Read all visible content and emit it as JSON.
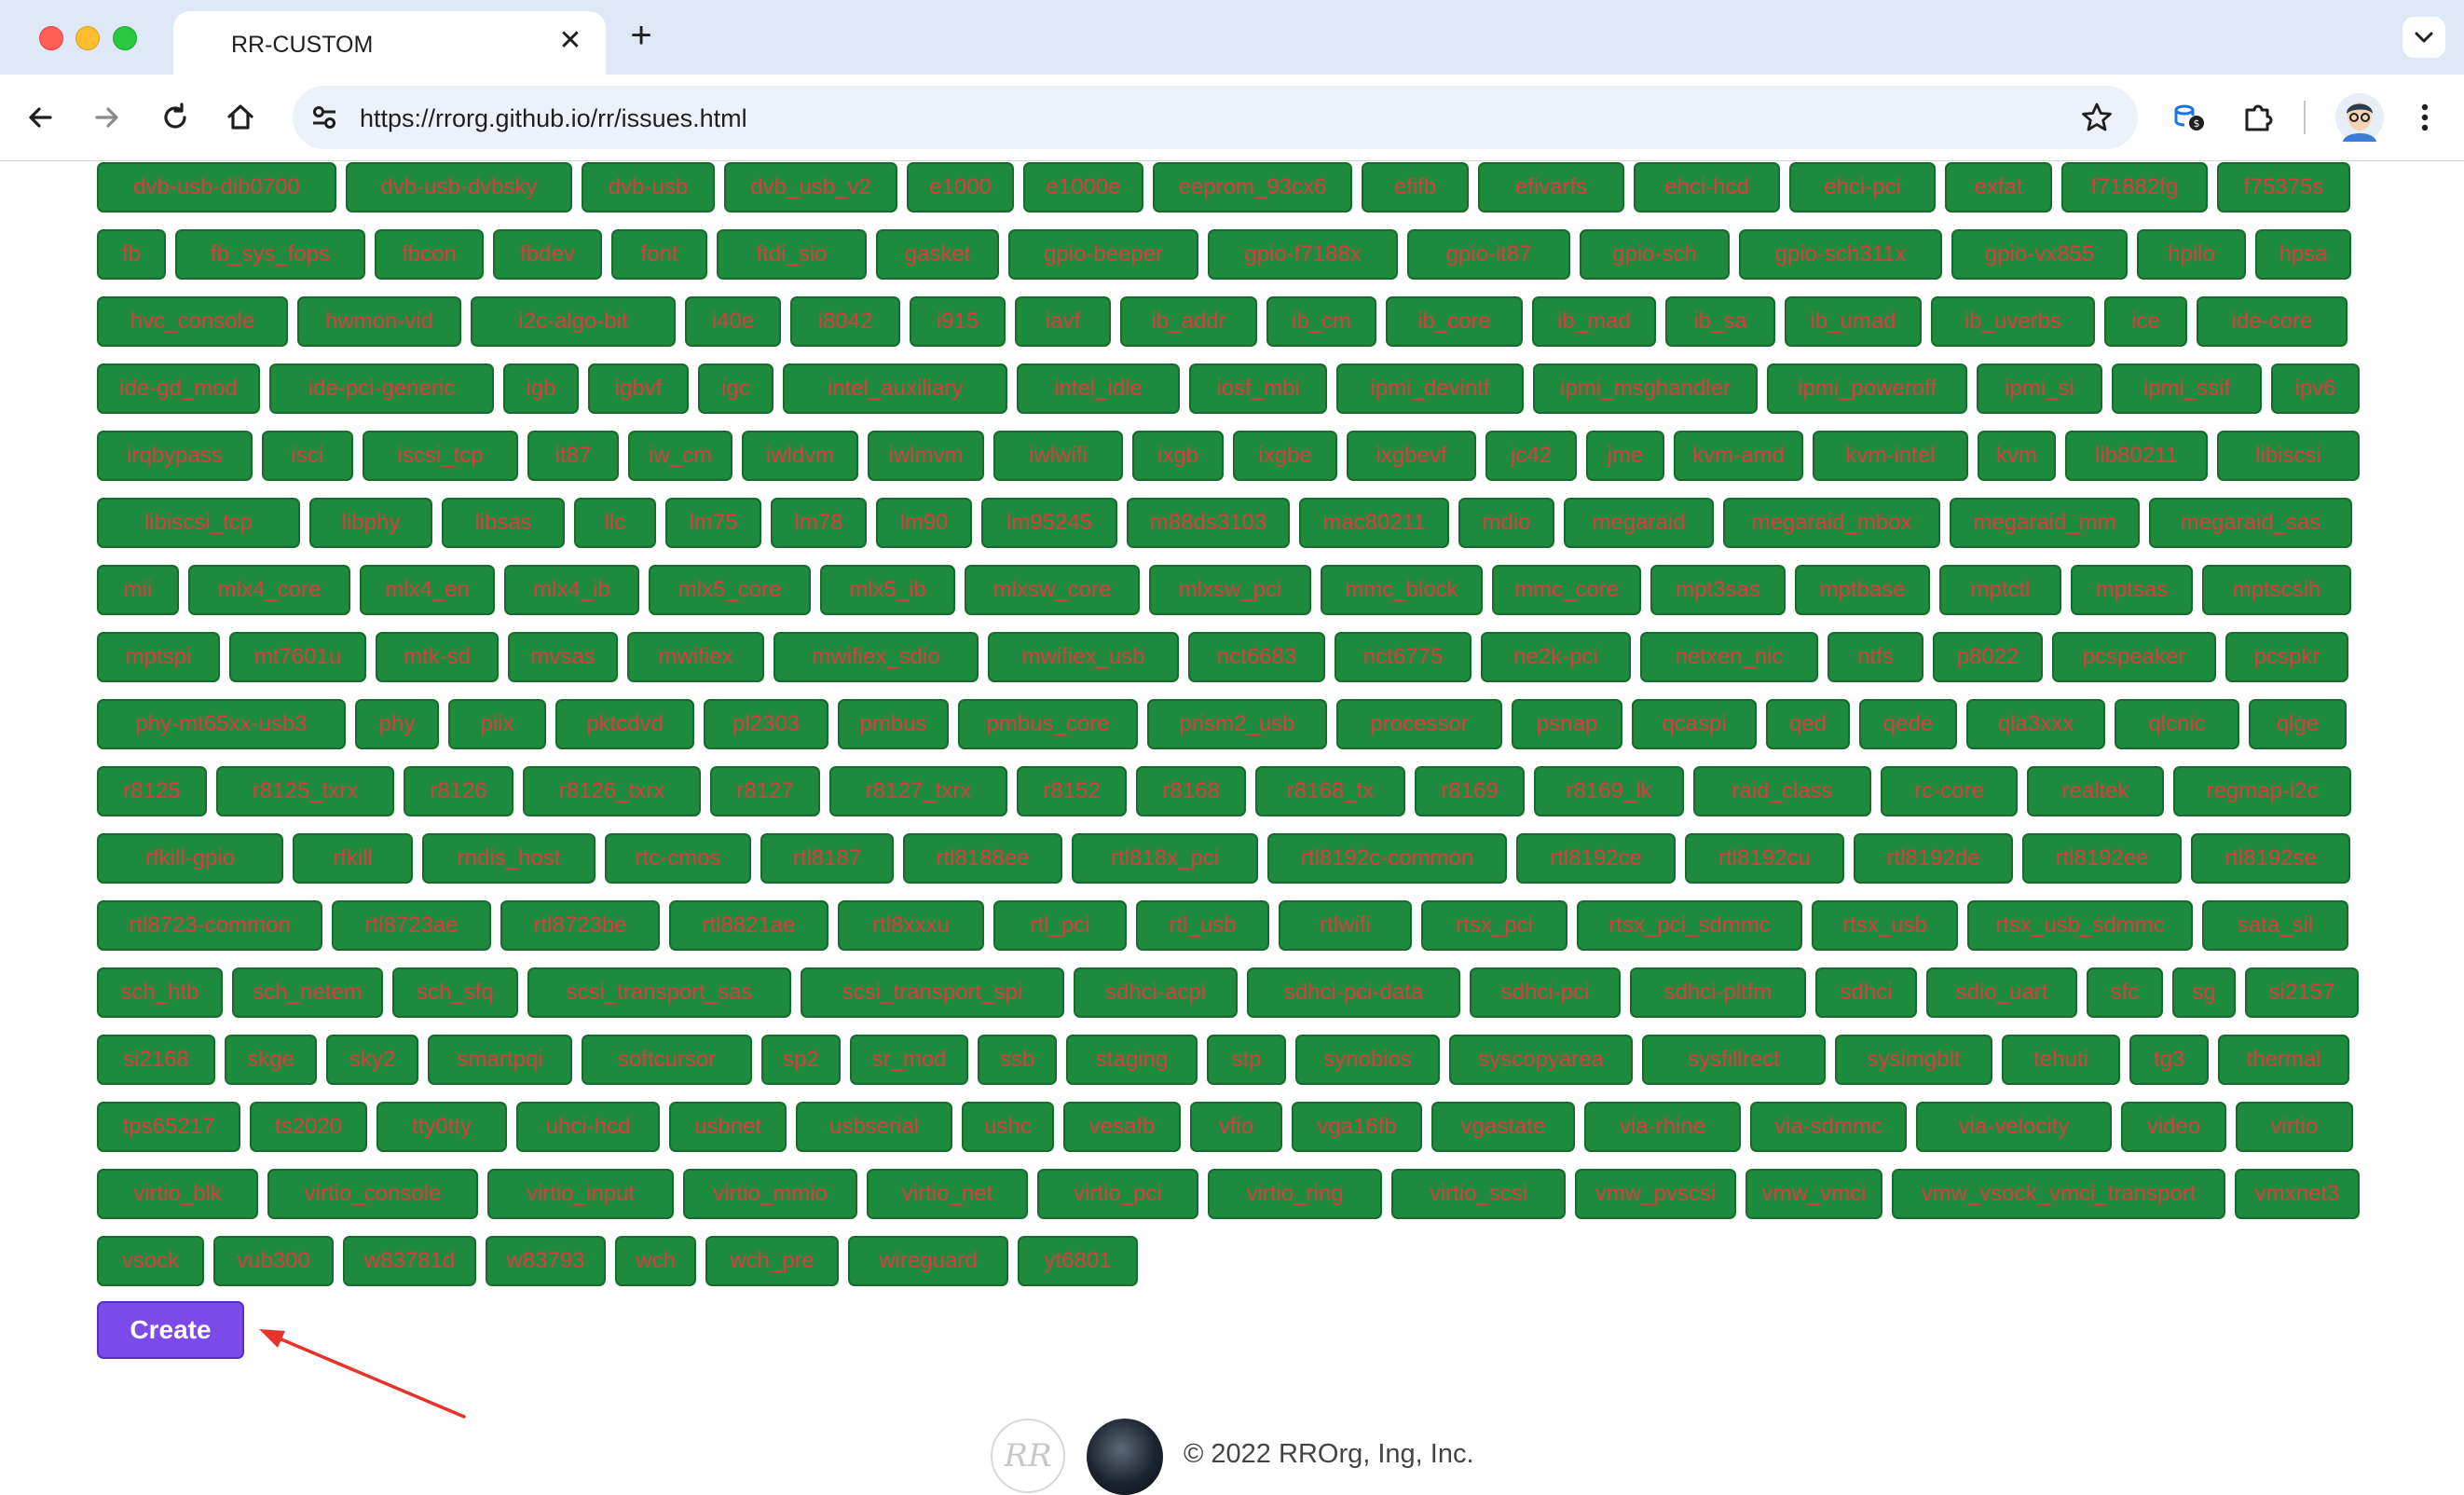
{
  "browser": {
    "tab_title": "RR-CUSTOM",
    "url": "https://rrorg.github.io/rr/issues.html"
  },
  "page": {
    "tags": [
      [
        "dvb-usb-dib0700",
        "dvb-usb-dvbsky",
        "dvb-usb",
        "dvb_usb_v2",
        "e1000",
        "e1000e",
        "eeprom_93cx6",
        "efifb",
        "efivarfs",
        "ehci-hcd",
        "ehci-pci",
        "exfat",
        "f71882fg",
        "f75375s"
      ],
      [
        "fb",
        "fb_sys_fops",
        "fbcon",
        "fbdev",
        "font",
        "ftdi_sio",
        "gasket",
        "gpio-beeper",
        "gpio-f7188x",
        "gpio-it87",
        "gpio-sch",
        "gpio-sch311x",
        "gpio-vx855",
        "hpilo",
        "hpsa"
      ],
      [
        "hvc_console",
        "hwmon-vid",
        "i2c-algo-bit",
        "i40e",
        "i8042",
        "i915",
        "iavf",
        "ib_addr",
        "ib_cm",
        "ib_core",
        "ib_mad",
        "ib_sa",
        "ib_umad",
        "ib_uverbs",
        "ice",
        "ide-core"
      ],
      [
        "ide-gd_mod",
        "ide-pci-generic",
        "igb",
        "igbvf",
        "igc",
        "intel_auxiliary",
        "intel_idle",
        "iosf_mbi",
        "ipmi_devintf",
        "ipmi_msghandler",
        "ipmi_poweroff",
        "ipmi_si",
        "ipmi_ssif",
        "ipv6"
      ],
      [
        "irqbypass",
        "isci",
        "iscsi_tcp",
        "it87",
        "iw_cm",
        "iwldvm",
        "iwlmvm",
        "iwlwifi",
        "ixgb",
        "ixgbe",
        "ixgbevf",
        "jc42",
        "jme",
        "kvm-amd",
        "kvm-intel",
        "kvm",
        "lib80211",
        "libiscsi"
      ],
      [
        "libiscsi_tcp",
        "libphy",
        "libsas",
        "llc",
        "lm75",
        "lm78",
        "lm90",
        "lm95245",
        "m88ds3103",
        "mac80211",
        "mdio",
        "megaraid",
        "megaraid_mbox",
        "megaraid_mm",
        "megaraid_sas"
      ],
      [
        "mii",
        "mlx4_core",
        "mlx4_en",
        "mlx4_ib",
        "mlx5_core",
        "mlx5_ib",
        "mlxsw_core",
        "mlxsw_pci",
        "mmc_block",
        "mmc_core",
        "mpt3sas",
        "mptbase",
        "mptctl",
        "mptsas",
        "mptscsih"
      ],
      [
        "mptspi",
        "mt7601u",
        "mtk-sd",
        "mvsas",
        "mwifiex",
        "mwifiex_sdio",
        "mwifiex_usb",
        "nct6683",
        "nct6775",
        "ne2k-pci",
        "netxen_nic",
        "ntfs",
        "p8022",
        "pcspeaker",
        "pcspkr"
      ],
      [
        "phy-mt65xx-usb3",
        "phy",
        "piix",
        "pktcdvd",
        "pl2303",
        "pmbus",
        "pmbus_core",
        "prism2_usb",
        "processor",
        "psnap",
        "qcaspi",
        "qed",
        "qede",
        "qla3xxx",
        "qlcnic",
        "qlge"
      ],
      [
        "r8125",
        "r8125_txrx",
        "r8126",
        "r8126_txrx",
        "r8127",
        "r8127_txrx",
        "r8152",
        "r8168",
        "r8168_tx",
        "r8169",
        "r8169_lk",
        "raid_class",
        "rc-core",
        "realtek",
        "regmap-i2c"
      ],
      [
        "rfkill-gpio",
        "rfkill",
        "rndis_host",
        "rtc-cmos",
        "rtl8187",
        "rtl8188ee",
        "rtl818x_pci",
        "rtl8192c-common",
        "rtl8192ce",
        "rtl8192cu",
        "rtl8192de",
        "rtl8192ee",
        "rtl8192se"
      ],
      [
        "rtl8723-common",
        "rtl8723ae",
        "rtl8723be",
        "rtl8821ae",
        "rtl8xxxu",
        "rtl_pci",
        "rtl_usb",
        "rtlwifi",
        "rtsx_pci",
        "rtsx_pci_sdmmc",
        "rtsx_usb",
        "rtsx_usb_sdmmc",
        "sata_sil"
      ],
      [
        "sch_htb",
        "sch_netem",
        "sch_sfq",
        "scsi_transport_sas",
        "scsi_transport_spi",
        "sdhci-acpi",
        "sdhci-pci-data",
        "sdhci-pci",
        "sdhci-pltfm",
        "sdhci",
        "sdio_uart",
        "sfc",
        "sg",
        "si2157"
      ],
      [
        "si2168",
        "skge",
        "sky2",
        "smartpqi",
        "softcursor",
        "sp2",
        "sr_mod",
        "ssb",
        "staging",
        "stp",
        "synobios",
        "syscopyarea",
        "sysfillrect",
        "sysimgblt",
        "tehuti",
        "tg3",
        "thermal"
      ],
      [
        "tps65217",
        "ts2020",
        "tty0tty",
        "uhci-hcd",
        "usbnet",
        "usbserial",
        "ushc",
        "vesafb",
        "vfio",
        "vga16fb",
        "vgastate",
        "via-rhine",
        "via-sdmmc",
        "via-velocity",
        "video",
        "virtio"
      ],
      [
        "virtio_blk",
        "virtio_console",
        "virtio_input",
        "virtio_mmio",
        "virtio_net",
        "virtio_pci",
        "virtio_ring",
        "virtio_scsi",
        "vmw_pvscsi",
        "vmw_vmci",
        "vmw_vsock_vmci_transport",
        "vmxnet3"
      ],
      [
        "vsock",
        "vub300",
        "w83781d",
        "w83793",
        "wch",
        "wch_pre",
        "wireguard",
        "yt6801"
      ]
    ],
    "create_label": "Create",
    "footer_logo_text": "RR",
    "footer_text": "© 2022 RROrg, Ing, Inc."
  },
  "colors": {
    "tag_bg": "#1d8a3d",
    "tag_text": "#d93c3c",
    "create_bg": "#7b4ae8",
    "annotation_arrow": "#e8322c"
  },
  "icons": [
    "back-icon",
    "forward-icon",
    "reload-icon",
    "home-icon",
    "site-settings-icon",
    "bookmark-star-icon",
    "extension-icon",
    "puzzle-icon",
    "profile-avatar",
    "kebab-menu-icon"
  ]
}
